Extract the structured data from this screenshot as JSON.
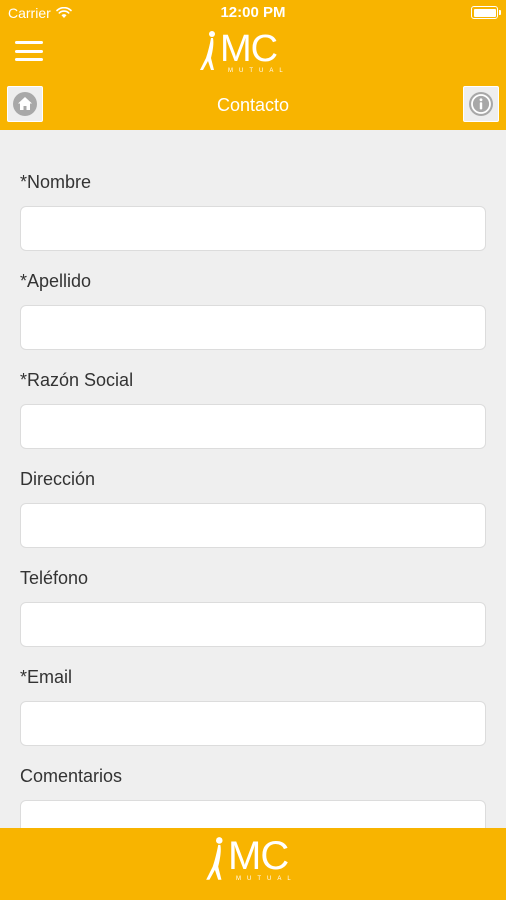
{
  "status_bar": {
    "carrier": "Carrier",
    "time": "12:00 PM"
  },
  "header": {
    "logo_text": "MC",
    "logo_subtext": "MUTUAL",
    "title": "Contacto",
    "icons": {
      "menu": "hamburger-menu-icon",
      "home": "home-icon",
      "info": "info-icon"
    }
  },
  "form": {
    "fields": [
      {
        "label": "*Nombre",
        "value": ""
      },
      {
        "label": "*Apellido",
        "value": ""
      },
      {
        "label": "*Razón Social",
        "value": ""
      },
      {
        "label": "Dirección",
        "value": ""
      },
      {
        "label": "Teléfono",
        "value": ""
      },
      {
        "label": "*Email",
        "value": ""
      },
      {
        "label": "Comentarios",
        "value": ""
      }
    ]
  },
  "footer": {
    "logo_text": "MC",
    "logo_subtext": "MUTUAL"
  },
  "colors": {
    "brand": "#f8b400",
    "background": "#efefef",
    "text": "#333333"
  }
}
